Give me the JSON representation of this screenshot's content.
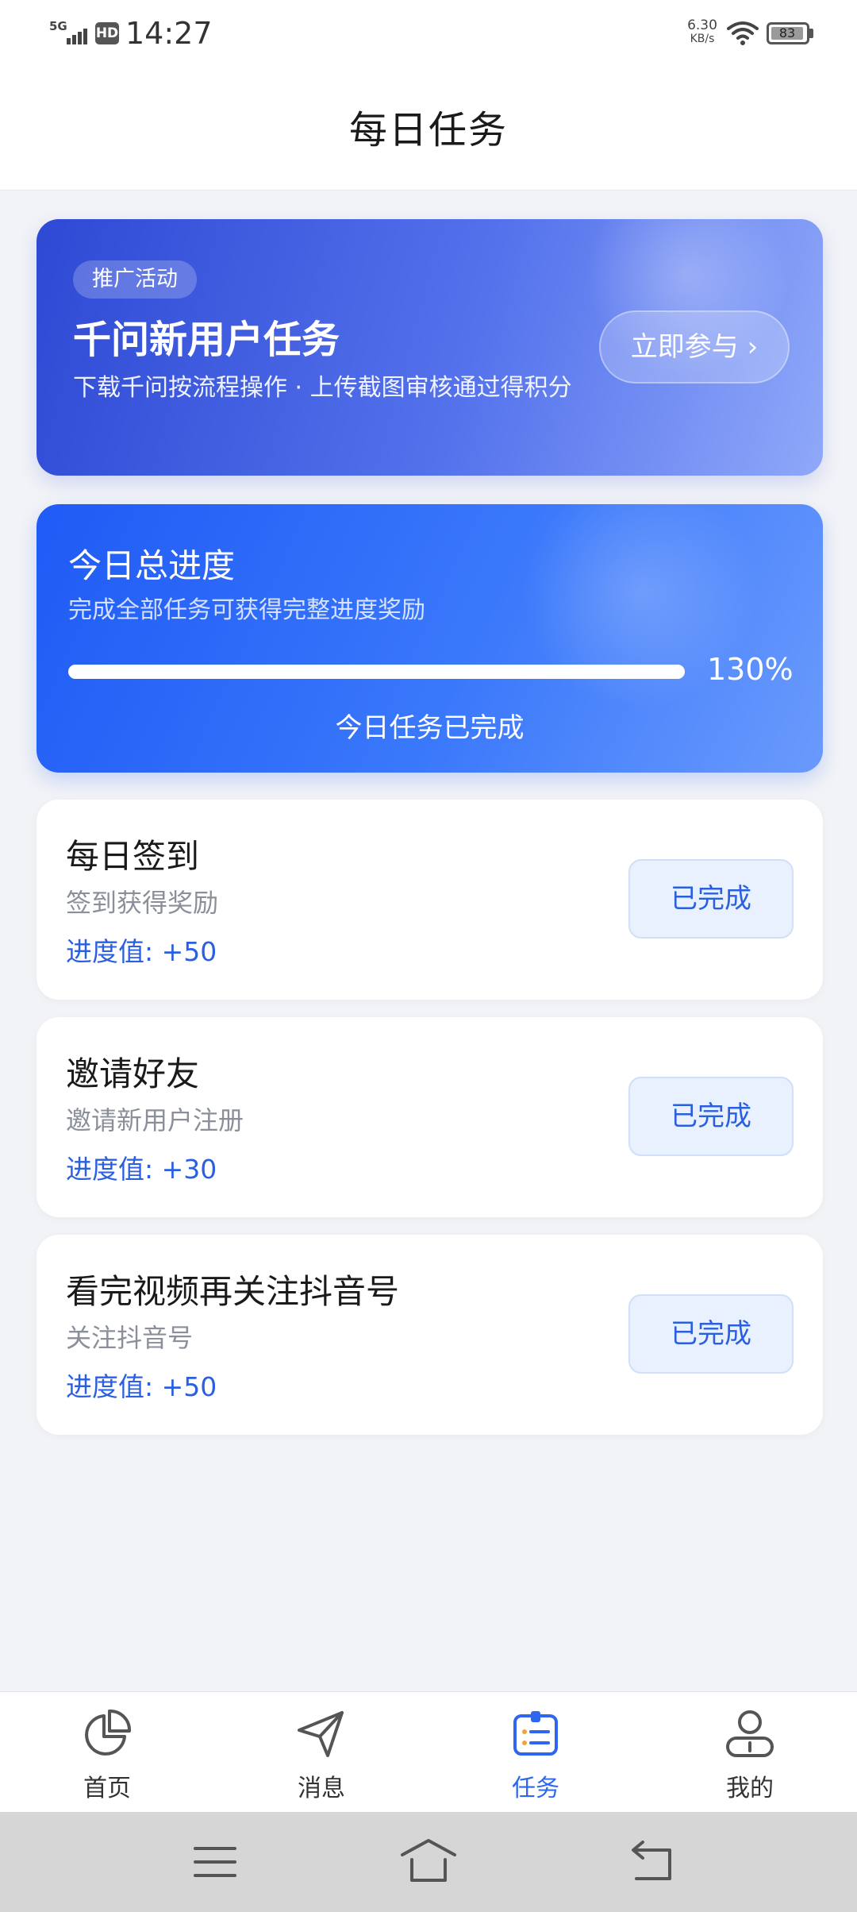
{
  "status_bar": {
    "network": "5G",
    "hd": "HD",
    "time": "14:27",
    "speed_value": "6.30",
    "speed_unit": "KB/s",
    "battery": "83"
  },
  "header": {
    "title": "每日任务"
  },
  "promo": {
    "tag": "推广活动",
    "title": "千问新用户任务",
    "description": "下载千问按流程操作 · 上传截图审核通过得积分",
    "button_label": "立即参与 ›"
  },
  "progress": {
    "title": "今日总进度",
    "subtitle": "完成全部任务可获得完整进度奖励",
    "percent_label": "130%",
    "fill_fraction": 1.0,
    "status": "今日任务已完成"
  },
  "tasks": [
    {
      "title": "每日签到",
      "description": "签到获得奖励",
      "points": "进度值: +50",
      "button_label": "已完成"
    },
    {
      "title": "邀请好友",
      "description": "邀请新用户注册",
      "points": "进度值: +30",
      "button_label": "已完成"
    },
    {
      "title": "看完视频再关注抖音号",
      "description": "关注抖音号",
      "points": "进度值: +50",
      "button_label": "已完成"
    }
  ],
  "nav": {
    "items": [
      {
        "label": "首页",
        "icon": "pie-chart-icon",
        "active": false
      },
      {
        "label": "消息",
        "icon": "send-icon",
        "active": false
      },
      {
        "label": "任务",
        "icon": "task-list-icon",
        "active": true
      },
      {
        "label": "我的",
        "icon": "user-icon",
        "active": false
      }
    ]
  },
  "system_nav": {
    "icons": [
      "menu-icon",
      "home-icon",
      "back-icon"
    ]
  },
  "colors": {
    "accent": "#2e66ef",
    "promo_gradient_start": "#2e49d4",
    "promo_gradient_end": "#8fa8f9",
    "progress_gradient_start": "#1f5bf5",
    "progress_gradient_end": "#6a9afc",
    "completed_button_bg": "#e8f1fd",
    "points_text": "#2a5fe0",
    "page_bg": "#f2f3f7"
  }
}
